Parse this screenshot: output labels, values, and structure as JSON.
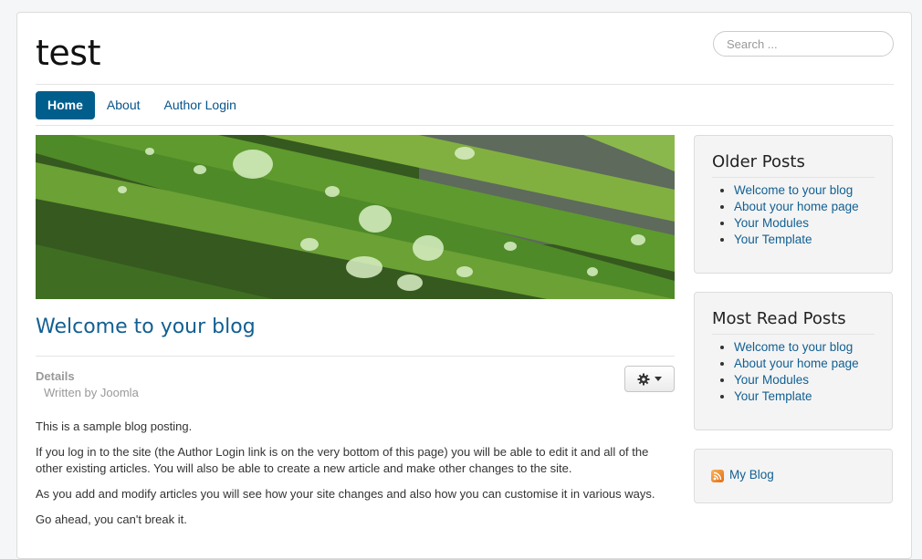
{
  "header": {
    "site_title": "test",
    "search_placeholder": "Search ..."
  },
  "nav": {
    "items": [
      {
        "label": "Home",
        "active": true
      },
      {
        "label": "About",
        "active": false
      },
      {
        "label": "Author Login",
        "active": false
      }
    ]
  },
  "article": {
    "title": "Welcome to your blog",
    "details_label": "Details",
    "author": "Written by Joomla",
    "tools_icon": "gear-icon",
    "paragraphs": [
      "This is a sample blog posting.",
      "If you log in to the site (the Author Login link is on the very bottom of this page) you will be able to edit it and all of the other existing articles. You will also be able to create a new article and make other changes to the site.",
      "As you add and modify articles you will see how your site changes and also how you can customise it in various ways.",
      "Go ahead, you can't break it."
    ]
  },
  "sidebar": {
    "older_posts": {
      "title": "Older Posts",
      "items": [
        "Welcome to your blog",
        "About your home page",
        "Your Modules",
        "Your Template"
      ]
    },
    "most_read": {
      "title": "Most Read Posts",
      "items": [
        "Welcome to your blog",
        "About your home page",
        "Your Modules",
        "Your Template"
      ]
    },
    "feed": {
      "label": "My Blog",
      "icon": "rss-icon"
    }
  },
  "colors": {
    "accent": "#005e8d",
    "link": "#125f92"
  }
}
